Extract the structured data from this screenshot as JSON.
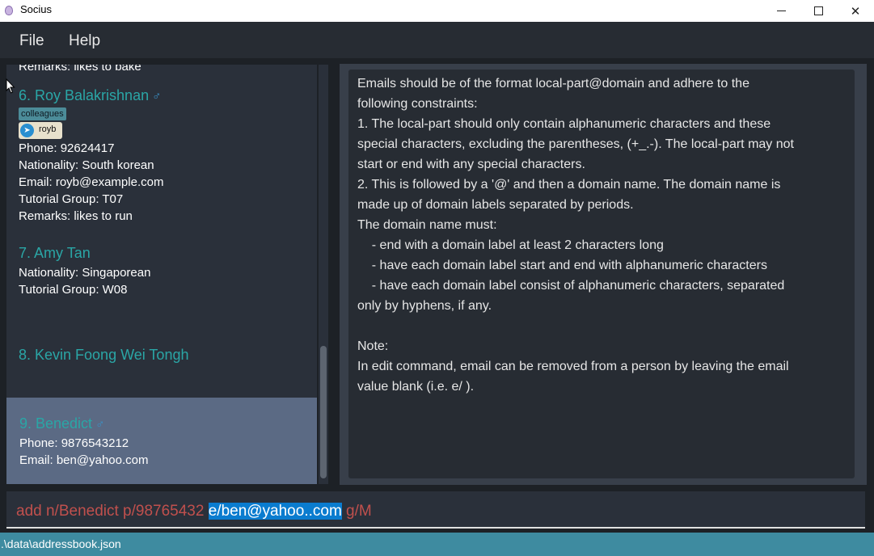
{
  "window": {
    "title": "Socius",
    "minimize_glyph": "",
    "close_glyph": "✕"
  },
  "menu": {
    "file": "File",
    "help": "Help"
  },
  "list": {
    "top_remark": "Remarks: likes to bake",
    "roy": {
      "heading": "6.  Roy Balakrishnan",
      "gender_icon": "male-icon",
      "tag": "colleagues",
      "telegram": "royb",
      "phone": "Phone: 92624417",
      "nationality": "Nationality: South korean",
      "email": "Email: royb@example.com",
      "tutorial": "Tutorial Group: T07",
      "remarks": "Remarks: likes to run"
    },
    "amy": {
      "heading": "7.  Amy Tan",
      "nationality": "Nationality: Singaporean",
      "tutorial": "Tutorial Group: W08"
    },
    "kevin": {
      "heading": "8.  Kevin Foong Wei Tongh"
    },
    "benedict": {
      "heading": "9.  Benedict",
      "phone": "Phone: 9876543212",
      "email": "Email: ben@yahoo.com"
    }
  },
  "result": {
    "lines": [
      "Emails should be of the format local-part@domain and adhere to the",
      "following constraints:",
      "1. The local-part should only contain alphanumeric characters and these",
      "special characters, excluding the parentheses, (+_.-). The local-part may not",
      "start or end with any special characters.",
      "2. This is followed by a '@' and then a domain name. The domain name is",
      "made up of domain labels separated by periods.",
      "The domain name must:",
      "    - end with a domain label at least 2 characters long",
      "    - have each domain label start and end with alphanumeric characters",
      "    - have each domain label consist of alphanumeric characters, separated",
      "only by hyphens, if any.",
      "",
      "Note:",
      "In edit command, email can be removed from a person by leaving the email",
      "value blank (i.e. e/ )."
    ]
  },
  "command": {
    "before": "add n/Benedict p/98765432 ",
    "selected": "e/ben@yahoo..com",
    "after": " g/M"
  },
  "status": {
    "path": ".\\data\\addressbook.json"
  },
  "colors": {
    "accent_name": "#2aa6a6",
    "error_text": "#c0504d",
    "selection": "#0a7ccf",
    "status_bar": "#3e8ba0"
  }
}
